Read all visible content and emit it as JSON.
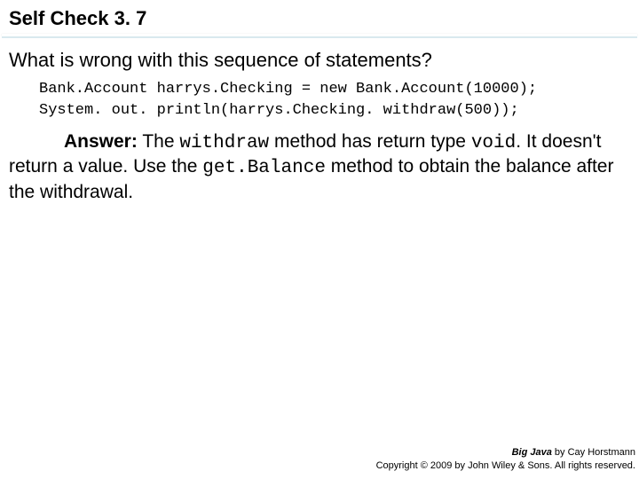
{
  "title": "Self Check 3. 7",
  "question": "What is wrong with this sequence of statements?",
  "code": {
    "line1": "Bank.Account harrys.Checking = new Bank.Account(10000);",
    "line2": "System. out. println(harrys.Checking. withdraw(500));"
  },
  "answer": {
    "label": "Answer:",
    "p1a": " The ",
    "p1b": "withdraw",
    "p1c": " method has return type ",
    "p1d": "void",
    "p1e": ". It doesn't return a value. Use the ",
    "p1f": "get.Balance",
    "p1g": " method to obtain the balance after the withdrawal."
  },
  "footer": {
    "book": "Big Java",
    "byline": " by Cay Horstmann",
    "copyright": "Copyright © 2009 by John Wiley & Sons. All rights reserved."
  }
}
